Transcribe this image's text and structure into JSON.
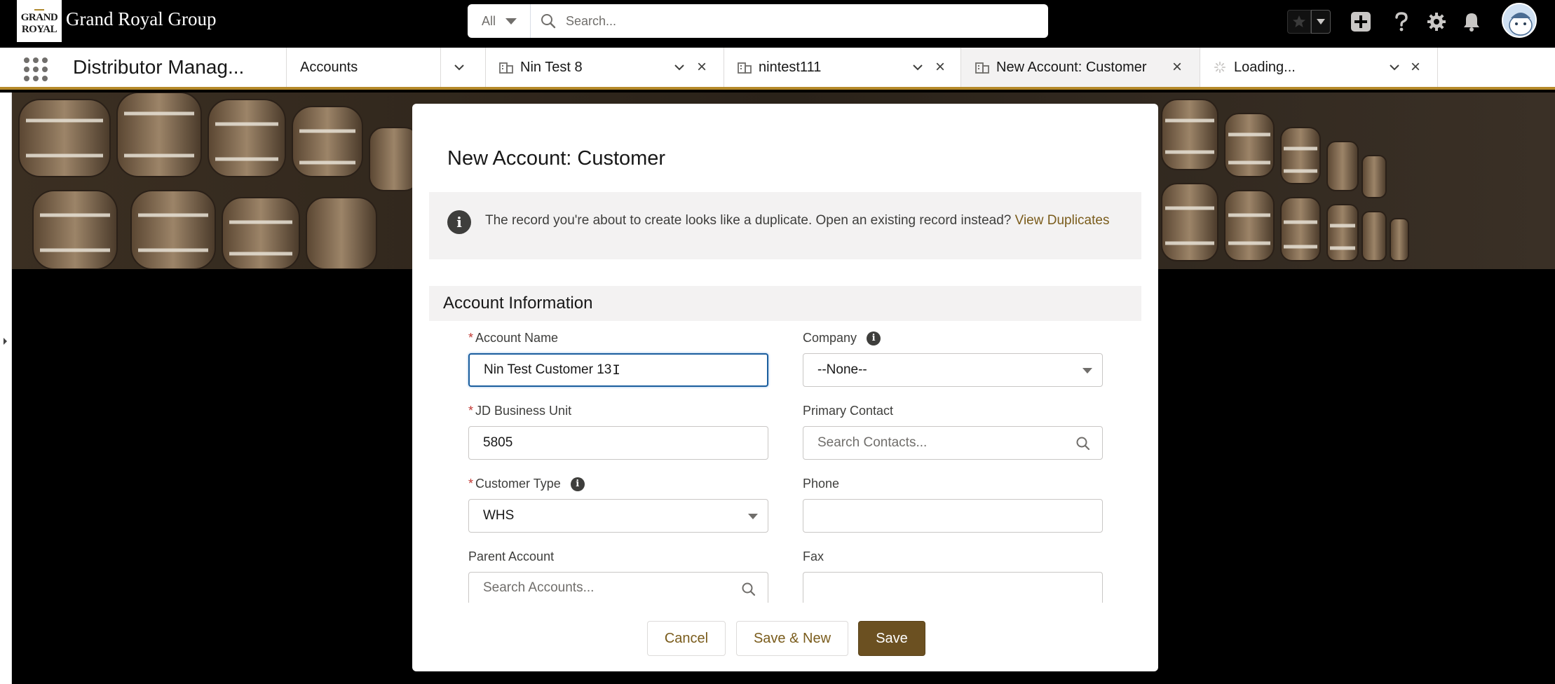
{
  "header": {
    "logo_line1": "GRAND",
    "logo_line2": "ROYAL",
    "org_name": "Grand Royal Group",
    "search_scope": "All",
    "search_placeholder": "Search..."
  },
  "nav": {
    "app_name": "Distributor Manag...",
    "accounts_label": "Accounts",
    "tabs": [
      {
        "label": "Nin Test 8"
      },
      {
        "label": "nintest111"
      },
      {
        "label": "New Account: Customer"
      },
      {
        "label": "Loading..."
      }
    ]
  },
  "modal": {
    "title": "New Account: Customer",
    "duplicate_text": "The record you're about to create looks like a duplicate. Open an existing record instead?",
    "duplicate_link": "View Duplicates",
    "section_title": "Account Information",
    "fields": {
      "account_name": {
        "label": "Account Name",
        "value": "Nin Test Customer 13"
      },
      "company": {
        "label": "Company",
        "value": "--None--"
      },
      "jd_business_unit": {
        "label": "JD Business Unit",
        "value": "5805"
      },
      "primary_contact": {
        "label": "Primary Contact",
        "placeholder": "Search Contacts..."
      },
      "customer_type": {
        "label": "Customer Type",
        "value": "WHS"
      },
      "phone": {
        "label": "Phone",
        "value": ""
      },
      "parent_account": {
        "label": "Parent Account",
        "placeholder": "Search Accounts..."
      },
      "fax": {
        "label": "Fax",
        "value": ""
      }
    },
    "buttons": {
      "cancel": "Cancel",
      "save_new": "Save & New",
      "save": "Save"
    }
  },
  "colors": {
    "brand": "#6b5021",
    "accent_bar": "#b58a2a",
    "link": "#7a5c1c"
  }
}
